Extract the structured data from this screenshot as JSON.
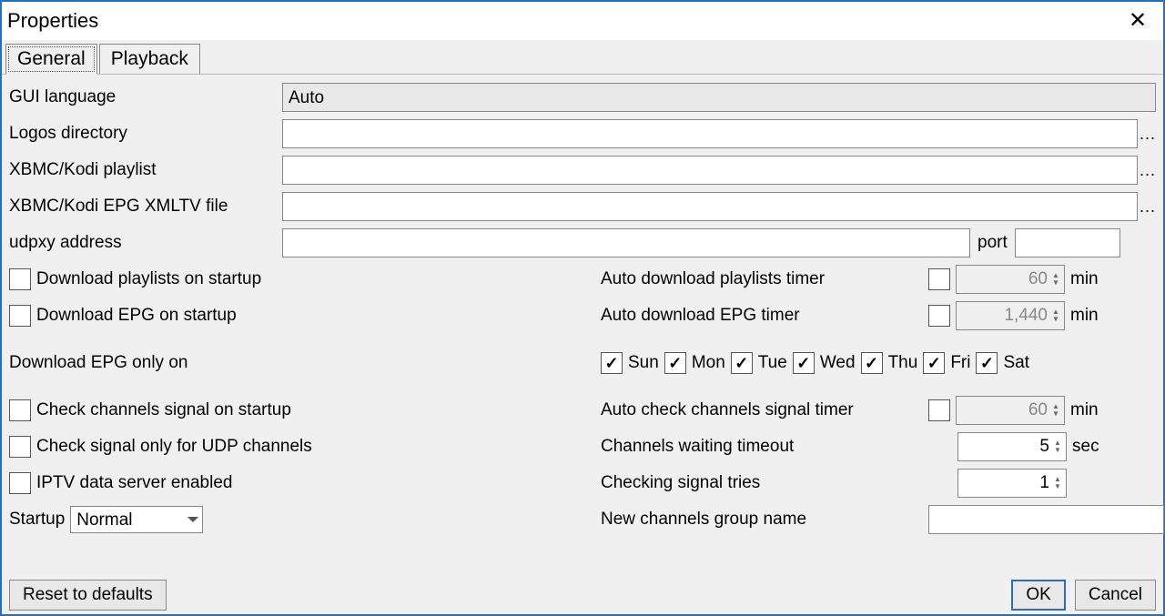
{
  "window": {
    "title": "Properties"
  },
  "tabs": {
    "general": "General",
    "playback": "Playback"
  },
  "labels": {
    "gui_language": "GUI language",
    "logos_dir": "Logos directory",
    "kodi_playlist": "XBMC/Kodi playlist",
    "kodi_epg": "XBMC/Kodi EPG XMLTV file",
    "udpxy_addr": "udpxy address",
    "port": "port",
    "dl_playlists_startup": "Download playlists on startup",
    "dl_epg_startup": "Download EPG on startup",
    "auto_dl_playlists_timer": "Auto download playlists timer",
    "auto_dl_epg_timer": "Auto download EPG timer",
    "dl_epg_only_on": "Download EPG only on",
    "check_channels_startup": "Check channels signal on startup",
    "check_udp_only": "Check signal only for UDP channels",
    "iptv_server_enabled": "IPTV data server enabled",
    "auto_check_signal_timer": "Auto check channels signal timer",
    "channels_wait_timeout": "Channels waiting timeout",
    "checking_signal_tries": "Checking signal tries",
    "new_channels_group": "New channels group name",
    "startup": "Startup"
  },
  "values": {
    "gui_language": "Auto",
    "logos_dir": "",
    "kodi_playlist": "",
    "kodi_epg": "",
    "udpxy_addr": "",
    "port": "",
    "auto_dl_playlists_timer": "60",
    "auto_dl_epg_timer": "1,440",
    "auto_check_signal_timer": "60",
    "channels_wait_timeout": "5",
    "checking_signal_tries": "1",
    "new_channels_group": "",
    "startup": "Normal"
  },
  "units": {
    "min": "min",
    "sec": "sec"
  },
  "days": {
    "sun": "Sun",
    "mon": "Mon",
    "tue": "Tue",
    "wed": "Wed",
    "thu": "Thu",
    "fri": "Fri",
    "sat": "Sat"
  },
  "buttons": {
    "reset": "Reset to defaults",
    "ok": "OK",
    "cancel": "Cancel",
    "browse": "..."
  }
}
